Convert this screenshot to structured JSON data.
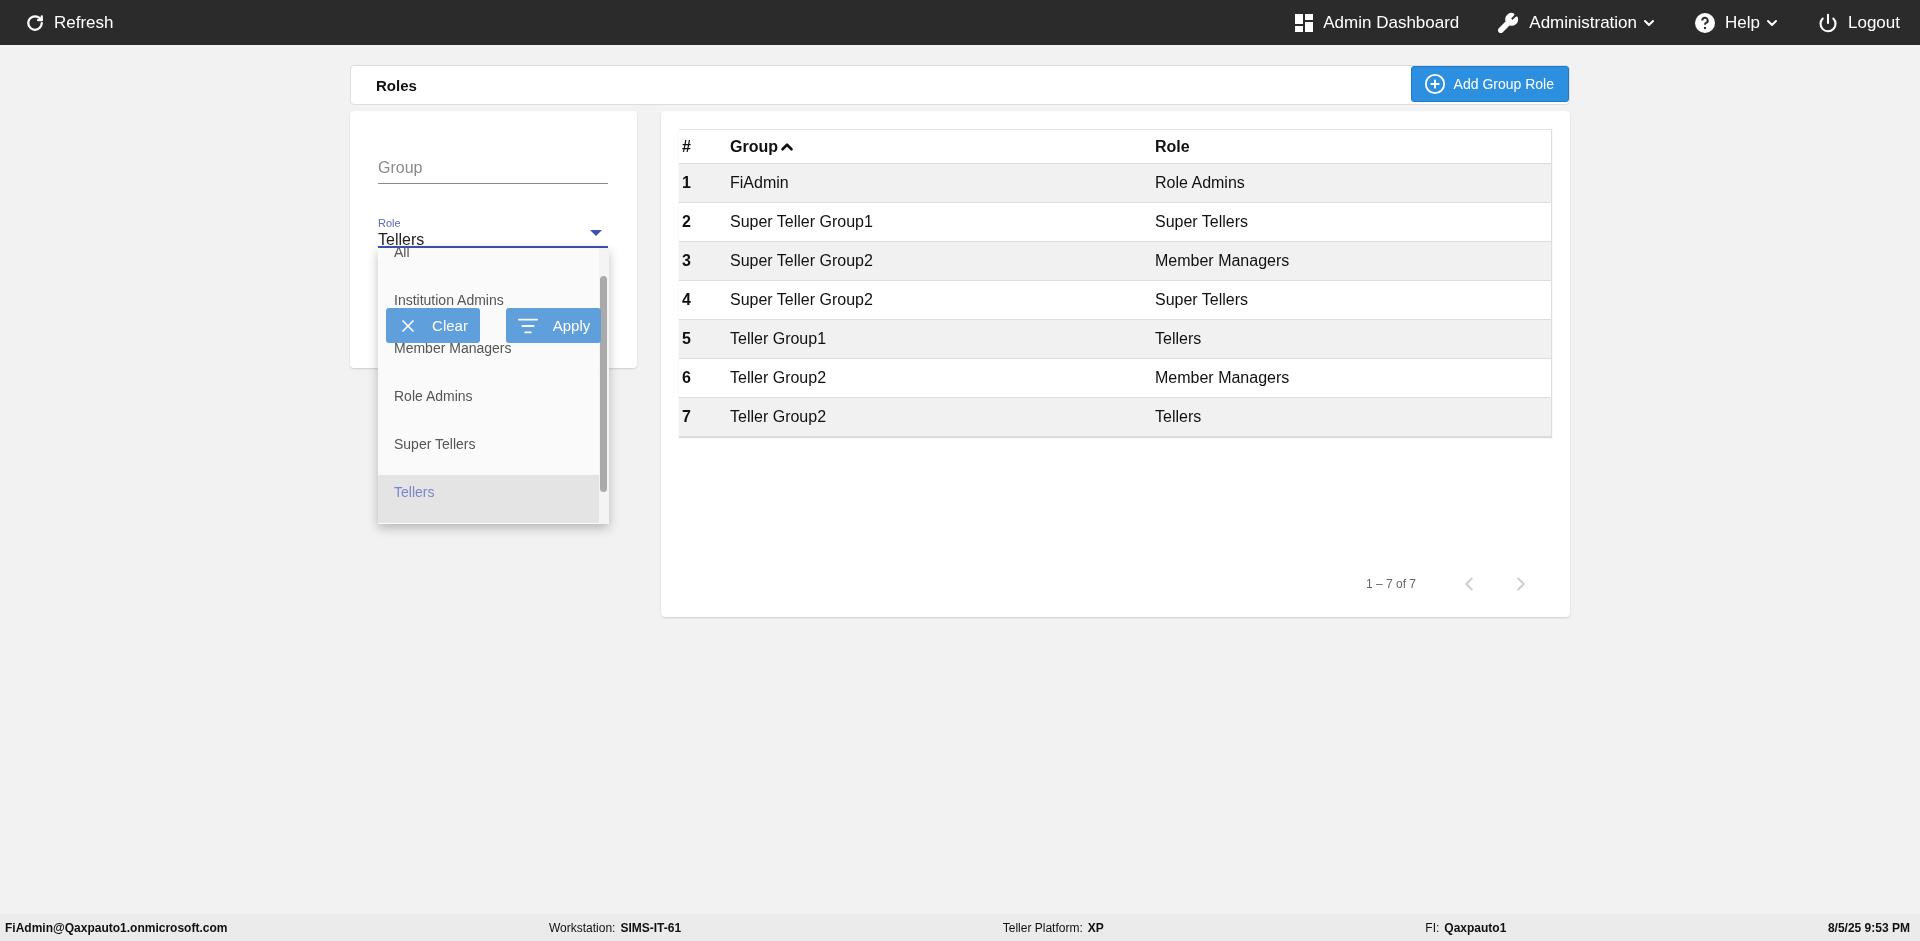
{
  "top_bar": {
    "refresh": "Refresh",
    "nav": [
      {
        "label": "Admin Dashboard",
        "kind": "dashboard",
        "has_menu": false
      },
      {
        "label": "Administration",
        "kind": "wrench",
        "has_menu": true
      },
      {
        "label": "Help",
        "kind": "help",
        "has_menu": true
      },
      {
        "label": "Logout",
        "kind": "power",
        "has_menu": false
      }
    ]
  },
  "page_header": {
    "title": "Roles",
    "add_button": "Add Group Role"
  },
  "filters": {
    "group": {
      "placeholder": "Group"
    },
    "role": {
      "label": "Role",
      "value": "Tellers",
      "expanded": true,
      "options": [
        {
          "label": "All",
          "selected": false
        },
        {
          "label": "Institution Admins",
          "selected": false
        },
        {
          "label": "Member Managers",
          "selected": false
        },
        {
          "label": "Role Admins",
          "selected": false
        },
        {
          "label": "Super Tellers",
          "selected": false
        },
        {
          "label": "Tellers",
          "selected": true
        }
      ]
    },
    "buttons": [
      {
        "label": "Clear",
        "kind": "clear"
      },
      {
        "label": "Apply",
        "kind": "apply"
      }
    ]
  },
  "table": {
    "columns": [
      {
        "label": "#"
      },
      {
        "label": "Group",
        "sorted_ascending": true
      },
      {
        "label": "Role"
      }
    ],
    "rows": [
      [
        "1",
        "FiAdmin",
        "Role Admins"
      ],
      [
        "2",
        "Super Teller Group1",
        "Super Tellers"
      ],
      [
        "3",
        "Super Teller Group2",
        "Member Managers"
      ],
      [
        "4",
        "Super Teller Group2",
        "Super Tellers"
      ],
      [
        "5",
        "Teller Group1",
        "Tellers"
      ],
      [
        "6",
        "Teller Group2",
        "Member Managers"
      ],
      [
        "7",
        "Teller Group2",
        "Tellers"
      ]
    ]
  },
  "pagination": {
    "range": "1 – 7 of 7",
    "prev_disabled": true,
    "next_disabled": true
  },
  "status_bar": [
    {
      "value": "FiAdmin@Qaxpauto1.onmicrosoft.com"
    },
    {
      "label": "Workstation:",
      "value": "SIMS-IT-61"
    },
    {
      "label": "Teller Platform:",
      "value": "XP"
    },
    {
      "label": "FI:",
      "value": "Qaxpauto1"
    },
    {
      "value": "8/5/25 9:53 PM"
    }
  ]
}
